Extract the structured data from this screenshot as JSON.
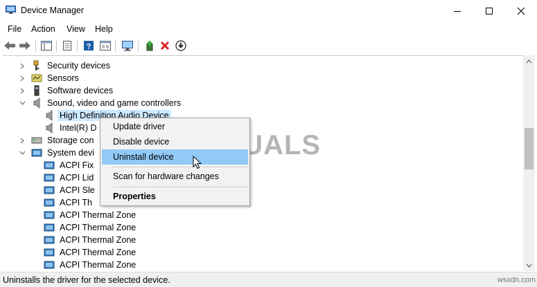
{
  "window": {
    "title": "Device Manager",
    "controls": {
      "minimize": "minimize",
      "maximize": "maximize",
      "close": "close"
    }
  },
  "menu": [
    "File",
    "Action",
    "View",
    "Help"
  ],
  "toolbar": {
    "buttons": [
      "back-arrow-icon",
      "forward-arrow-icon",
      "show-hide-tree-icon",
      "properties-sheet-icon",
      "help-icon",
      "view-toggle-icon",
      "monitor-icon",
      "update-driver-icon",
      "uninstall-x-icon",
      "download-icon"
    ],
    "accent_red": "#d9232a",
    "accent_blue": "#1b5faa"
  },
  "tree": {
    "rows": [
      {
        "label": "Security devices",
        "expander": "collapsed",
        "icon": "security-key-icon",
        "level": 0
      },
      {
        "label": "Sensors",
        "expander": "collapsed",
        "icon": "sensor-icon",
        "level": 0
      },
      {
        "label": "Software devices",
        "expander": "collapsed",
        "icon": "software-device-icon",
        "level": 0
      },
      {
        "label": "Sound, video and game controllers",
        "expander": "expanded",
        "icon": "speaker-icon",
        "level": 0
      },
      {
        "label": "High Definition Audio Device",
        "expander": "",
        "icon": "speaker-icon",
        "level": 1,
        "selected": true
      },
      {
        "label": "Intel(R) D",
        "expander": "",
        "icon": "speaker-icon",
        "level": 1
      },
      {
        "label": "Storage con",
        "expander": "collapsed",
        "icon": "storage-icon",
        "level": 0
      },
      {
        "label": "System devi",
        "expander": "expanded",
        "icon": "system-folder-icon",
        "level": 0
      },
      {
        "label": "ACPI Fix",
        "expander": "",
        "icon": "system-device-icon",
        "level": 1
      },
      {
        "label": "ACPI Lid",
        "expander": "",
        "icon": "system-device-icon",
        "level": 1
      },
      {
        "label": "ACPI Sle",
        "expander": "",
        "icon": "system-device-icon",
        "level": 1
      },
      {
        "label": "ACPI Th",
        "expander": "",
        "icon": "system-device-icon",
        "level": 1
      },
      {
        "label": "ACPI Thermal Zone",
        "expander": "",
        "icon": "system-device-icon",
        "level": 1
      },
      {
        "label": "ACPI Thermal Zone",
        "expander": "",
        "icon": "system-device-icon",
        "level": 1
      },
      {
        "label": "ACPI Thermal Zone",
        "expander": "",
        "icon": "system-device-icon",
        "level": 1
      },
      {
        "label": "ACPI Thermal Zone",
        "expander": "",
        "icon": "system-device-icon",
        "level": 1
      },
      {
        "label": "ACPI Thermal Zone",
        "expander": "",
        "icon": "system-device-icon",
        "level": 1
      }
    ],
    "selection_color": "#cce8ff"
  },
  "context_menu": {
    "items": [
      "Update driver",
      "Disable device",
      "Uninstall device",
      "Scan for hardware changes",
      "Properties"
    ],
    "highlighted": "Uninstall device",
    "highlight_color": "#91c9f7"
  },
  "status": {
    "text": "Uninstalls the driver for the selected device."
  },
  "watermark": {
    "text": "A  PUALS",
    "site": "wsxdn.com"
  }
}
